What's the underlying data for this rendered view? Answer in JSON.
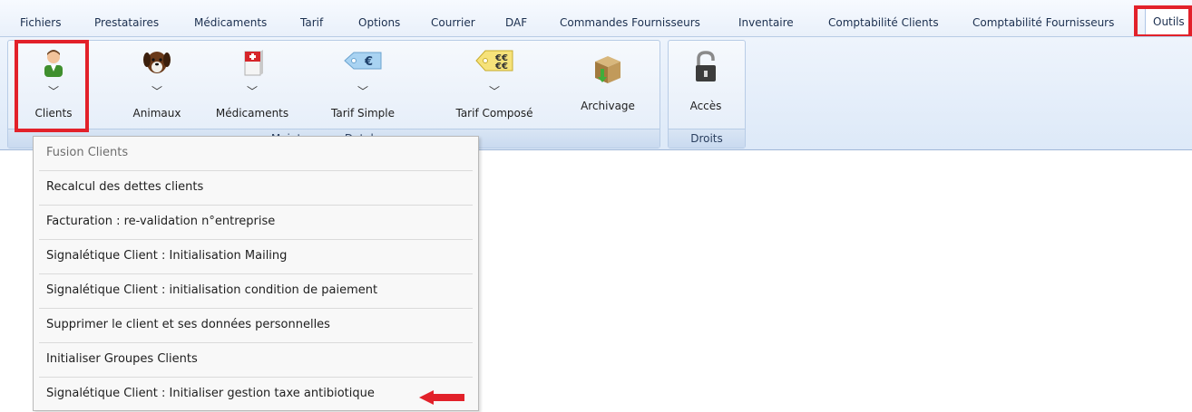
{
  "menu": [
    {
      "label": "Fichiers"
    },
    {
      "label": "Prestataires"
    },
    {
      "label": "Médicaments"
    },
    {
      "label": "Tarif"
    },
    {
      "label": "Options"
    },
    {
      "label": "Courrier"
    },
    {
      "label": "DAF"
    },
    {
      "label": "Commandes Fournisseurs"
    },
    {
      "label": "Inventaire"
    },
    {
      "label": "Comptabilité Clients"
    },
    {
      "label": "Comptabilité Fournisseurs"
    },
    {
      "label": "Outils"
    }
  ],
  "ribbon": {
    "buttons": [
      {
        "label": "Clients",
        "icon": "person-icon"
      },
      {
        "label": "Animaux",
        "icon": "dog-icon"
      },
      {
        "label": "Médicaments",
        "icon": "medicine-box-icon"
      },
      {
        "label": "Tarif Simple",
        "icon": "euro-tag-icon"
      },
      {
        "label": "Tarif Composé",
        "icon": "quotes-tag-icon"
      },
      {
        "label": "Archivage",
        "icon": "archive-box-icon"
      },
      {
        "label": "Accès",
        "icon": "padlock-icon"
      }
    ],
    "groups": [
      {
        "label": "Maintenance Database"
      },
      {
        "label": "Droits"
      }
    ]
  },
  "dropdown": {
    "items": [
      {
        "label": "Fusion Clients"
      },
      {
        "label": "Recalcul des dettes clients"
      },
      {
        "label": "Facturation : re-validation n°entreprise"
      },
      {
        "label": "Signalétique Client : Initialisation Mailing"
      },
      {
        "label": "Signalétique Client : initialisation condition de paiement"
      },
      {
        "label": "Supprimer le client et ses données personnelles"
      },
      {
        "label": "Initialiser Groupes Clients"
      },
      {
        "label": "Signalétique Client : Initialiser gestion taxe antibiotique"
      }
    ]
  },
  "colors": {
    "highlight": "#e2212a",
    "ribbon": "#dde9f8"
  }
}
